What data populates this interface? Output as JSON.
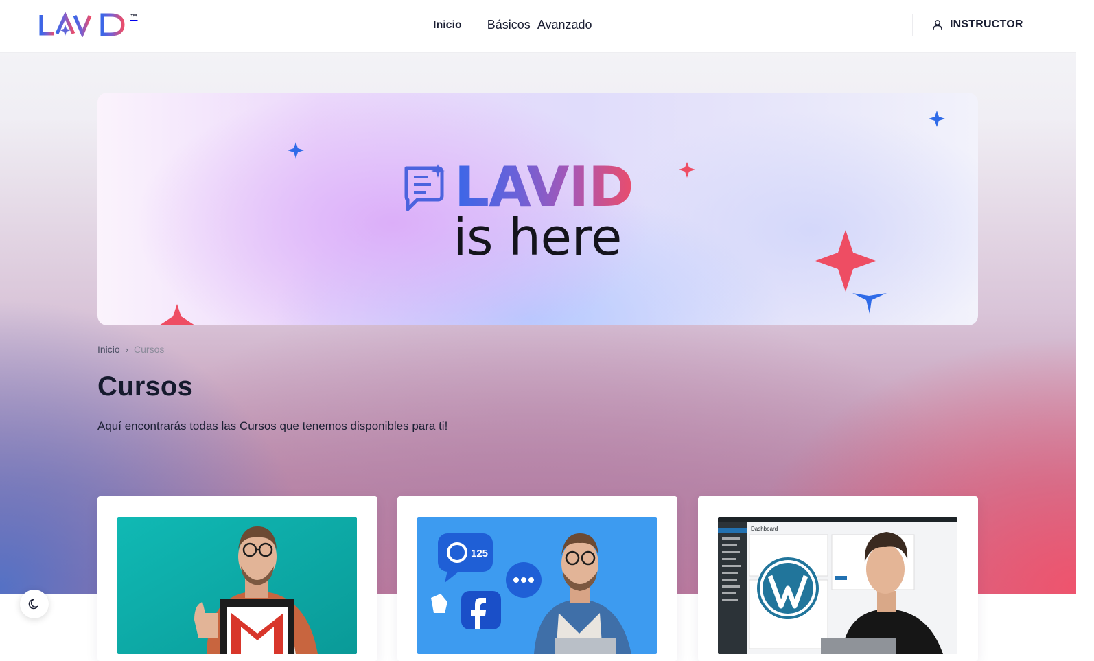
{
  "header": {
    "logo_text": "LAVID",
    "logo_tm": "™",
    "nav": {
      "inicio": "Inicio",
      "basicos": "Básicos",
      "avanzado": "Avanzado"
    },
    "instructor_label": "INSTRUCTOR"
  },
  "banner": {
    "title": "LAVID",
    "subtitle": "is here"
  },
  "breadcrumb": {
    "home": "Inicio",
    "separator": "›",
    "current": "Cursos"
  },
  "page": {
    "title": "Cursos",
    "description": "Aquí encontrarás todas las Cursos que tenemos disponibles para ti!"
  },
  "cards": [
    {
      "thumbnail_icon": "gmail-icon"
    },
    {
      "thumbnail_icon": "facebook-icon",
      "badge": "125"
    },
    {
      "thumbnail_icon": "wordpress-icon",
      "screen_title": "Dashboard"
    }
  ],
  "theme_toggle_icon": "moon-icon",
  "colors": {
    "brand_blue": "#3a67e8",
    "brand_pink": "#ea4d6b",
    "text_dark": "#151a2d"
  }
}
